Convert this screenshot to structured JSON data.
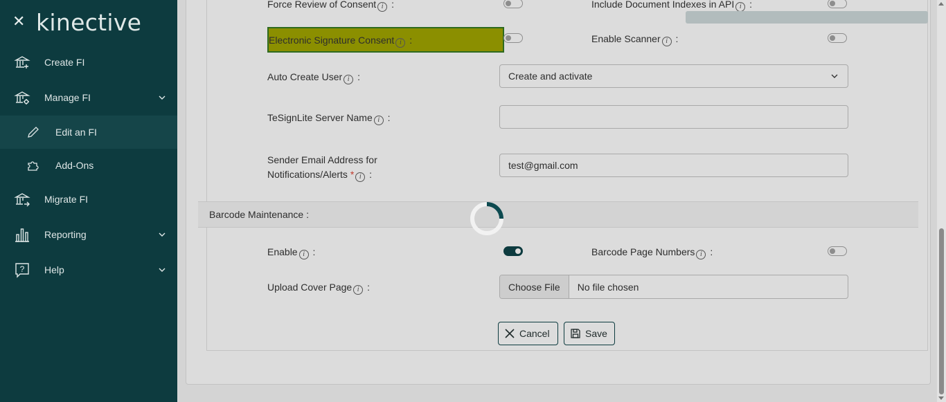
{
  "brand": {
    "logo_text": "kinective"
  },
  "sidebar": {
    "items": [
      {
        "label": "Create FI",
        "icon": "bank-plus-icon"
      },
      {
        "label": "Manage FI",
        "icon": "bank-gear-icon"
      },
      {
        "label": "Edit an FI",
        "icon": "pencil-icon"
      },
      {
        "label": "Add-Ons",
        "icon": "puzzle-icon"
      },
      {
        "label": "Migrate FI",
        "icon": "bank-arrow-icon"
      },
      {
        "label": "Reporting",
        "icon": "bar-chart-icon"
      },
      {
        "label": "Help",
        "icon": "question-icon"
      }
    ]
  },
  "form": {
    "force_review_label": "Force Review of Consent",
    "include_doc_indexes_label": "Include Document Indexes in API",
    "esign_consent_label": "Electronic Signature Consent",
    "enable_scanner_label": "Enable Scanner",
    "auto_create_user_label": "Auto Create User",
    "auto_create_user_value": "Create and activate",
    "tesignlite_label": "TeSignLite Server Name",
    "tesignlite_value": "",
    "sender_email_label_line1": "Sender Email Address for",
    "sender_email_label_line2": "Notifications/Alerts",
    "sender_email_value": "test@gmail.com",
    "colon": ":"
  },
  "barcode": {
    "section_title": "Barcode Maintenance :",
    "enable_label": "Enable",
    "page_numbers_label": "Barcode Page Numbers",
    "upload_cover_label": "Upload Cover Page",
    "choose_file_label": "Choose File",
    "file_status": "No file chosen"
  },
  "actions": {
    "cancel_label": "Cancel",
    "save_label": "Save"
  },
  "colors": {
    "sidebar_bg": "#0d3b3f",
    "highlight": "#8b8f00",
    "accent": "#0d3b3f"
  }
}
